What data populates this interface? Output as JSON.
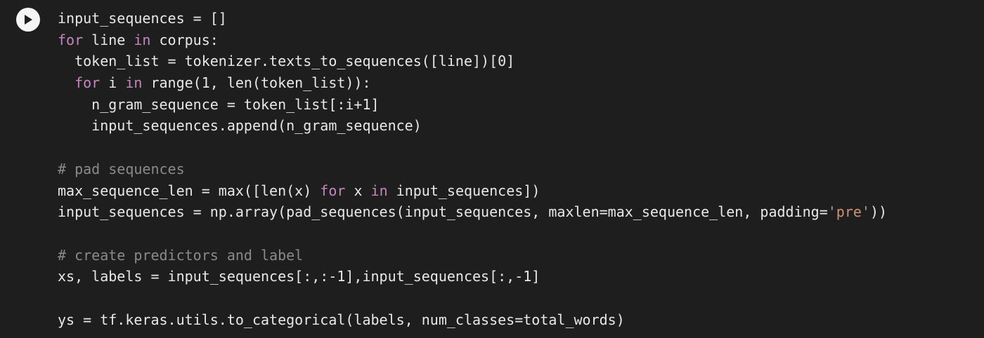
{
  "run_button": {
    "icon": "play-icon",
    "label": ""
  },
  "code_lines": [
    [
      {
        "t": "input_sequences = []",
        "c": "tx"
      }
    ],
    [
      {
        "t": "for",
        "c": "kw"
      },
      {
        "t": " line ",
        "c": "tx"
      },
      {
        "t": "in",
        "c": "kw"
      },
      {
        "t": " corpus:",
        "c": "tx"
      }
    ],
    [
      {
        "t": "  token_list = tokenizer.texts_to_sequences([line])[0]",
        "c": "tx"
      }
    ],
    [
      {
        "t": "  ",
        "c": "tx"
      },
      {
        "t": "for",
        "c": "kw"
      },
      {
        "t": " i ",
        "c": "tx"
      },
      {
        "t": "in",
        "c": "kw"
      },
      {
        "t": " range(1, len(token_list)):",
        "c": "tx"
      }
    ],
    [
      {
        "t": "    n_gram_sequence = token_list[:i+1]",
        "c": "tx"
      }
    ],
    [
      {
        "t": "    input_sequences.append(n_gram_sequence)",
        "c": "tx"
      }
    ],
    [],
    [
      {
        "t": "# pad sequences",
        "c": "cm"
      }
    ],
    [
      {
        "t": "max_sequence_len = max([len(x) ",
        "c": "tx"
      },
      {
        "t": "for",
        "c": "kw"
      },
      {
        "t": " x ",
        "c": "tx"
      },
      {
        "t": "in",
        "c": "kw"
      },
      {
        "t": " input_sequences])",
        "c": "tx"
      }
    ],
    [
      {
        "t": "input_sequences = np.array(pad_sequences(input_sequences, maxlen=max_sequence_len, padding=",
        "c": "tx"
      },
      {
        "t": "'pre'",
        "c": "st"
      },
      {
        "t": "))",
        "c": "tx"
      }
    ],
    [],
    [
      {
        "t": "# create predictors and label",
        "c": "cm"
      }
    ],
    [
      {
        "t": "xs, labels = input_sequences[:,:-1],input_sequences[:,-1]",
        "c": "tx"
      }
    ],
    [],
    [
      {
        "t": "ys = tf.keras.utils.to_categorical(labels, num_classes=total_words)",
        "c": "tx"
      }
    ]
  ]
}
